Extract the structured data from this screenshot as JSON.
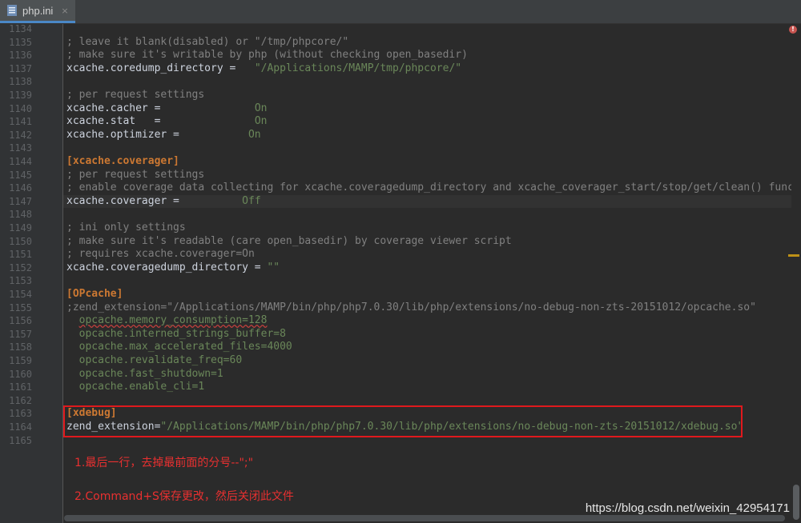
{
  "tab": {
    "filename": "php.ini",
    "close": "×"
  },
  "line_numbers": [
    "1134",
    "1135",
    "1136",
    "1137",
    "1138",
    "1139",
    "1140",
    "1141",
    "1142",
    "1143",
    "1144",
    "1145",
    "1146",
    "1147",
    "1148",
    "1149",
    "1150",
    "1151",
    "1152",
    "1153",
    "1154",
    "1155",
    "1156",
    "1157",
    "1158",
    "1159",
    "1160",
    "1161",
    "1162",
    "1163",
    "1164",
    "1165"
  ],
  "code": {
    "l1135": "; leave it blank(disabled) or \"/tmp/phpcore/\"",
    "l1136": "; make sure it's writable by php (without checking open_basedir)",
    "l1137_key": "xcache.coredump_directory =",
    "l1137_val": "\"/Applications/MAMP/tmp/phpcore/\"",
    "l1139": "; per request settings",
    "l1140_key": "xcache.cacher =",
    "l1140_val": "On",
    "l1141_key": "xcache.stat   =",
    "l1141_val": "On",
    "l1142_key": "xcache.optimizer =",
    "l1142_val": "On",
    "l1144": "[xcache.coverager]",
    "l1145": "; per request settings",
    "l1146": "; enable coverage data collecting for xcache.coveragedump_directory and xcache_coverager_start/stop/get/clean() functic",
    "l1147_key": "xcache.coverager =",
    "l1147_val": "Off",
    "l1149": "; ini only settings",
    "l1150": "; make sure it's readable (care open_basedir) by coverage viewer script",
    "l1151": "; requires xcache.coverager=On",
    "l1152_key": "xcache.coveragedump_directory =",
    "l1152_val": "\"\"",
    "l1154": "[OPcache]",
    "l1155_key": ";zend_extension=",
    "l1155_val": "\"/Applications/MAMP/bin/php/php7.0.30/lib/php/extensions/no-debug-non-zts-20151012/opcache.so\"",
    "l1156": "opcache.memory_consumption=128",
    "l1157": "opcache.interned_strings_buffer=8",
    "l1158": "opcache.max_accelerated_files=4000",
    "l1159": "opcache.revalidate_freq=60",
    "l1160": "opcache.fast_shutdown=1",
    "l1161": "opcache.enable_cli=1",
    "l1163": "[xdebug]",
    "l1164_key": "zend_extension=",
    "l1164_val": "\"/Applications/MAMP/bin/php/php7.0.30/lib/php/extensions/no-debug-non-zts-20151012/xdebug.so\""
  },
  "annotations": {
    "note1": "1.最后一行，去掉最前面的分号--\";\"",
    "note2": "2.Command+S保存更改，然后关闭此文件"
  },
  "watermark": "https://blog.csdn.net/weixin_42954171",
  "colors": {
    "annotation_red": "#e0191d",
    "section_orange": "#cc7832",
    "string_green": "#6a8759",
    "comment_gray": "#808080"
  }
}
